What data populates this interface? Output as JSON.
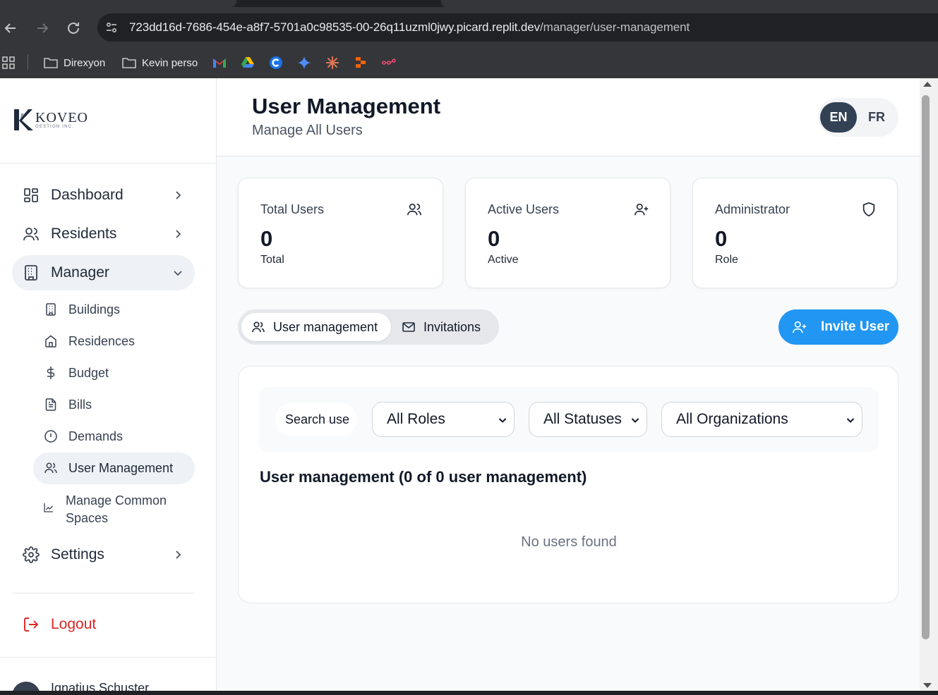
{
  "browser": {
    "url_host": "723dd16d-7686-454e-a8f7-5701a0c98535-00-26q11uzml0jwy.picard.replit.dev",
    "url_path": "/manager/user-management",
    "bookmarks": [
      {
        "label": "Direxyon"
      },
      {
        "label": "Kevin perso"
      }
    ]
  },
  "logo": {
    "name": "KOVEO",
    "tagline": "GESTION INC."
  },
  "sidebar": {
    "dashboard": "Dashboard",
    "residents": "Residents",
    "manager": "Manager",
    "sub_items": {
      "buildings": "Buildings",
      "residences": "Residences",
      "budget": "Budget",
      "bills": "Bills",
      "demands": "Demands",
      "user_management": "User Management",
      "common_spaces_line1": "Manage Common",
      "common_spaces_line2": "Spaces"
    },
    "settings": "Settings",
    "logout": "Logout",
    "user_name": "Ignatius Schuster"
  },
  "header": {
    "title": "User Management",
    "subtitle": "Manage All Users",
    "lang_en": "EN",
    "lang_fr": "FR"
  },
  "stats": {
    "total": {
      "title": "Total Users",
      "value": "0",
      "caption": "Total"
    },
    "active": {
      "title": "Active Users",
      "value": "0",
      "caption": "Active"
    },
    "admin": {
      "title": "Administrator",
      "value": "0",
      "caption": "Role"
    }
  },
  "tabs": {
    "user_management": "User management",
    "invitations": "Invitations"
  },
  "invite_button": "Invite User",
  "filters": {
    "search_placeholder": "Search users...",
    "roles": "All Roles",
    "statuses": "All Statuses",
    "organizations": "All Organizations"
  },
  "results": {
    "title": "User management (0 of 0 user management)",
    "empty": "No users found"
  },
  "colors": {
    "accent": "#2196f3",
    "lang_active": "#334155",
    "logout": "#dc2626"
  }
}
